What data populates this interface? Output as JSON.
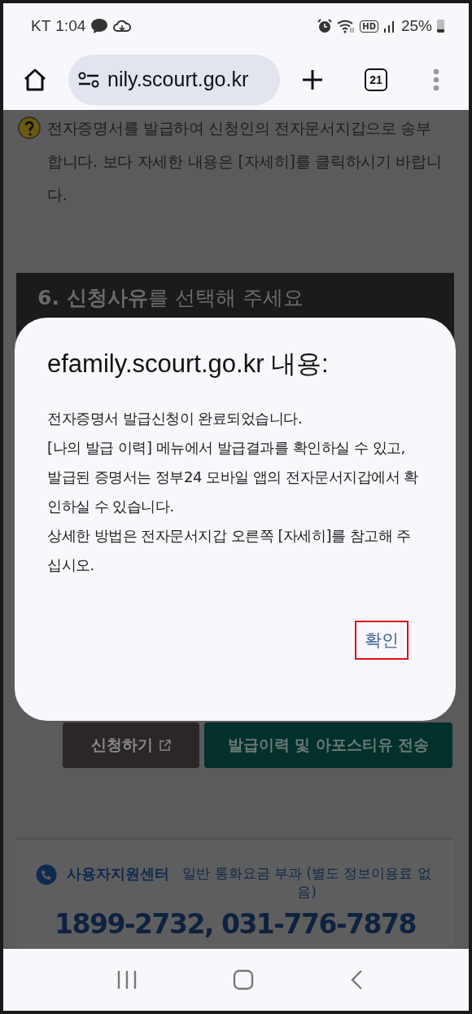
{
  "status_bar": {
    "carrier": "KT",
    "time": "1:04",
    "hd_label": "HD",
    "battery": "25%"
  },
  "browser_toolbar": {
    "url": "nily.scourt.go.kr",
    "tab_count": "21"
  },
  "page": {
    "help_text": "전자증명서를 발급하여 신청인의 전자문서지갑으로 송부합니다. 보다 자세한 내용은 [자세히]를 클릭하시기 바랍니다.",
    "section_heading": "**6. 신청사유**를 선택해 주세요",
    "buttons": [
      {
        "label": "신청하기",
        "kind": "external"
      },
      {
        "label": "발급이력 및 아포스티유 전송",
        "kind": "primary"
      }
    ],
    "support": {
      "title": "사용자지원센터",
      "note": "일반 통화요금 부과 (별도 정보이용료 없음)",
      "phone": "1899-2732, 031-776-7878"
    }
  },
  "dialog": {
    "title": "efamily.scourt.go.kr 내용:",
    "message": [
      "전자증명서 발급신청이 완료되었습니다.",
      "[나의 발급 이력] 메뉴에서 발급결과를 확인하실 수 있고, 발급된 증명서는 정부24 모바일 앱의 전자문서지갑에서 확인하실 수 있습니다.",
      "상세한 방법은 전자문서지갑 오른쪽 [자세히]를 참고해 주십시오."
    ],
    "confirm": {
      "label": "확인",
      "highlighted": true
    }
  }
}
